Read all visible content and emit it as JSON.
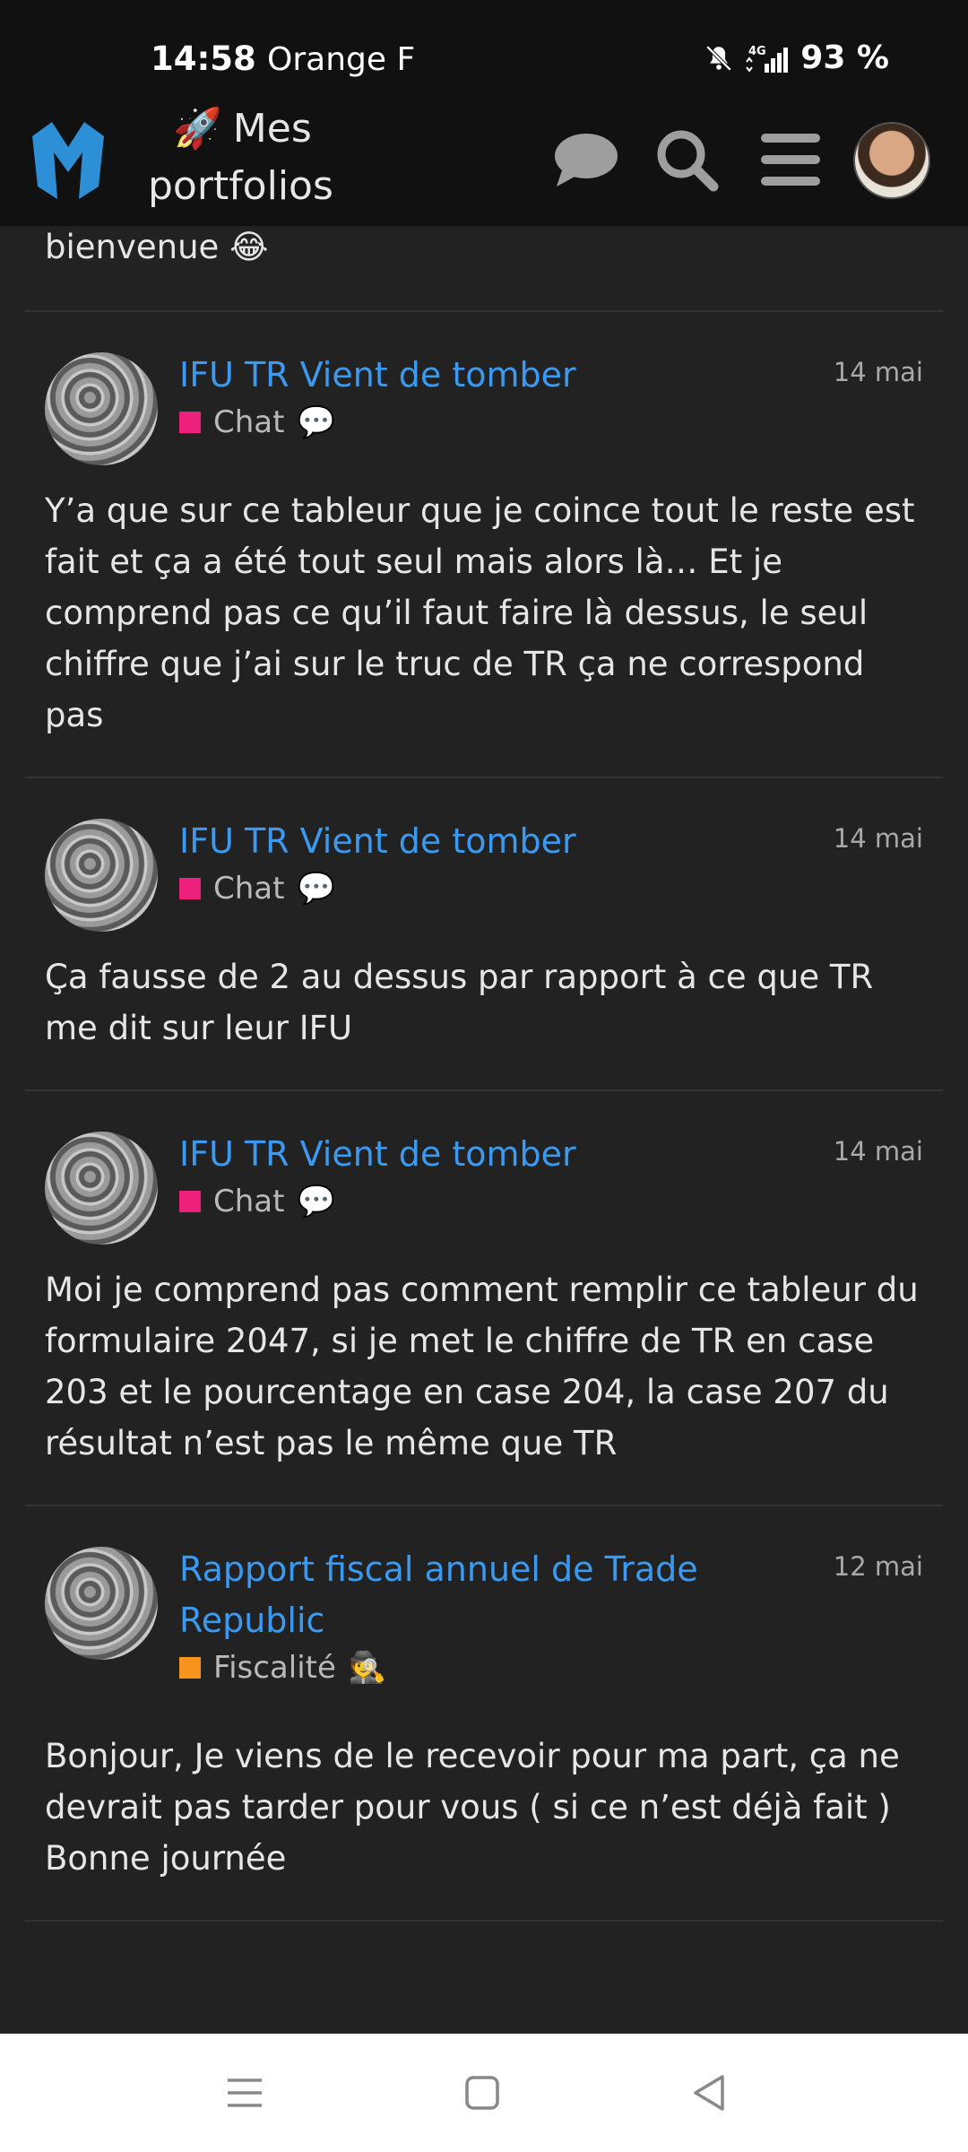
{
  "status_bar": {
    "time": "14:58",
    "carrier": "Orange F",
    "network": "4G",
    "battery": "93 %"
  },
  "header": {
    "site_title_emoji": "🚀",
    "site_title": "Mes portfolios",
    "icons": [
      "chat-icon",
      "search-icon",
      "menu-icon",
      "avatar"
    ]
  },
  "previous_tail": {
    "text": "bienvenue",
    "emoji": "😂"
  },
  "posts": [
    {
      "title": "IFU TR Vient de tomber",
      "date": "14 mai",
      "category": "Chat",
      "category_emoji": "💬",
      "category_color": "#ed207b",
      "excerpt": "Y’a que sur ce tableur que je coince tout le reste est fait et ça a été tout seul mais alors là… Et je comprend pas ce qu’il faut faire là dessus, le seul chiffre que j’ai sur le truc de TR ça ne correspond pas"
    },
    {
      "title": "IFU TR Vient de tomber",
      "date": "14 mai",
      "category": "Chat",
      "category_emoji": "💬",
      "category_color": "#ed207b",
      "excerpt": "Ça fausse de 2 au dessus par rapport à ce que TR me dit sur leur IFU"
    },
    {
      "title": "IFU TR Vient de tomber",
      "date": "14 mai",
      "category": "Chat",
      "category_emoji": "💬",
      "category_color": "#ed207b",
      "excerpt": "Moi je comprend pas comment remplir ce tableur du formulaire 2047, si je met le chiffre de TR en case 203 et le pourcentage en case 204, la case 207 du résultat n’est pas le même que TR"
    },
    {
      "title": "Rapport fiscal annuel de Trade Republic",
      "date": "12 mai",
      "category": "Fiscalité",
      "category_emoji": "🕵",
      "category_color": "#f7941d",
      "excerpt": "Bonjour, Je viens de le recevoir pour ma part, ça ne devrait pas tarder pour vous ( si ce n’est déjà fait ) Bonne journée"
    }
  ],
  "colors": {
    "background": "#222222",
    "header": "#111111",
    "link": "#3b9af0",
    "logo": "#2d8fd5"
  },
  "nav_bar": [
    "recent-apps-icon",
    "home-icon",
    "back-icon"
  ]
}
